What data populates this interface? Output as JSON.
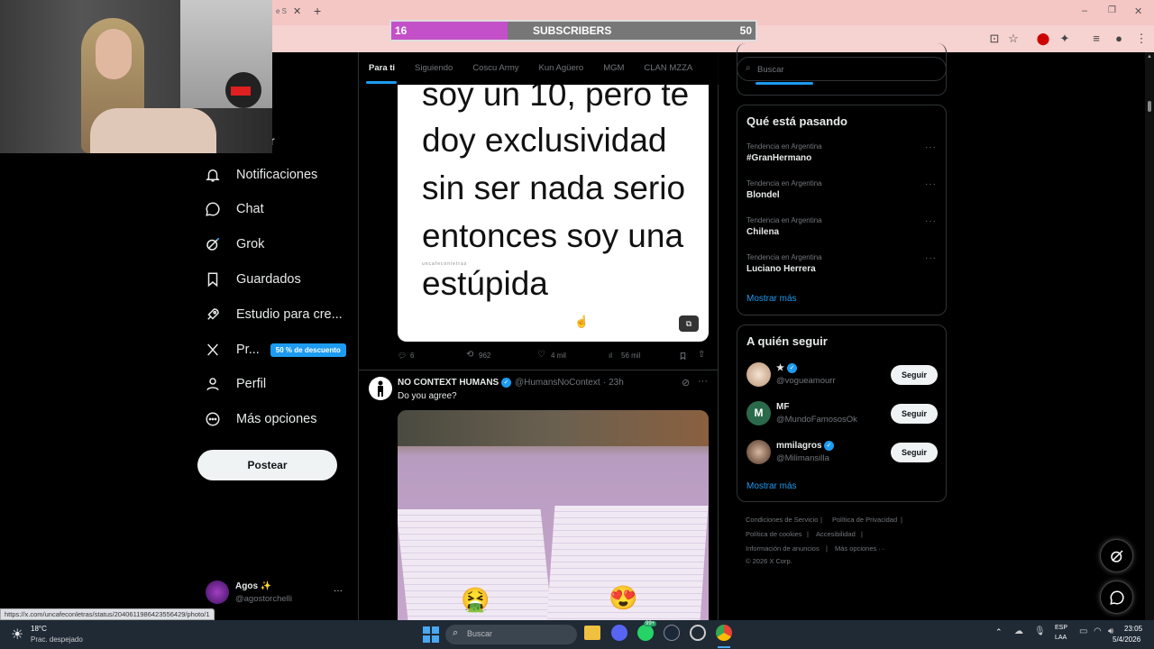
{
  "browser": {
    "tab_partial": "e S",
    "new_tab": "+",
    "window_controls": [
      "–",
      "❐",
      "✕"
    ]
  },
  "overlay": {
    "subscribers_current": "16",
    "subscribers_label": "SUBSCRIBERS",
    "subscribers_goal": "50",
    "progress_fraction": 0.32
  },
  "sidebar": {
    "partial_label": "r",
    "items": [
      {
        "label": "Notificaciones",
        "icon": "bell-icon"
      },
      {
        "label": "Chat",
        "icon": "chat-icon"
      },
      {
        "label": "Grok",
        "icon": "grok-icon"
      },
      {
        "label": "Guardados",
        "icon": "bookmark-icon"
      },
      {
        "label": "Estudio para cre...",
        "icon": "rocket-icon"
      },
      {
        "label": "Pr...",
        "icon": "x-logo-icon"
      },
      {
        "label": "Perfil",
        "icon": "person-icon"
      },
      {
        "label": "Más opciones",
        "icon": "more-circle-icon"
      }
    ],
    "premium_badge": "50 % de descuento",
    "post_button": "Postear",
    "account_name": "Agos ✨",
    "account_handle": "@agostorchelli",
    "account_more": "···"
  },
  "timeline": {
    "tabs": [
      "Para ti",
      "Siguiendo",
      "Coscu Army",
      "Kun Agüero",
      "MGM",
      "CLAN MZZA"
    ],
    "active_tab": 0,
    "tweet1": {
      "image_lines": [
        "soy un 10, pero te",
        "doy     exclusividad",
        "sin ser nada serio",
        "entonces  soy una",
        "estúpida"
      ],
      "watermark": "uncafeconletras",
      "replies": "6",
      "reposts": "962",
      "likes": "4 mil",
      "views": "56 mil"
    },
    "tweet2": {
      "author": "NO CONTEXT HUMANS",
      "handle": "@HumansNoContext",
      "time": "· 23h",
      "text": "Do you agree?",
      "emoji_left": "🤮",
      "emoji_right": "😍"
    }
  },
  "right": {
    "search_placeholder": "Buscar",
    "trends_title": "Qué está pasando",
    "trends": [
      {
        "meta": "Tendencia en Argentina",
        "name": "#GranHermano"
      },
      {
        "meta": "Tendencia en Argentina",
        "name": "Blondel"
      },
      {
        "meta": "Tendencia en Argentina",
        "name": "Chilena"
      },
      {
        "meta": "Tendencia en Argentina",
        "name": "Luciano Herrera"
      }
    ],
    "show_more": "Mostrar más",
    "follow_title": "A quién seguir",
    "follow": [
      {
        "name": "★",
        "handle": "@vogueamourr",
        "button": "Seguir"
      },
      {
        "name": "MF",
        "handle": "@MundoFamososOk",
        "button": "Seguir"
      },
      {
        "name": "mmilagros",
        "handle": "@Milimansilla",
        "button": "Seguir"
      }
    ],
    "follow_more": "Mostrar más",
    "footer": [
      "Condiciones de Servicio",
      "|",
      "Política de Privacidad",
      "|",
      "Política de cookies",
      "|",
      "Accesibilidad",
      "|",
      "Información de anuncios",
      "|",
      "Más opciones ···",
      "© 2026 X Corp."
    ]
  },
  "status_url": "https://x.com/uncafeconletras/status/2040611986423556429/photo/1",
  "taskbar": {
    "weather_temp": "18°C",
    "weather_desc": "Prac. despejado",
    "search_placeholder": "Buscar",
    "lang_top": "ESP",
    "lang_bottom": "LAA",
    "time": "23:05",
    "date": "5/4/2026",
    "badge": "99+"
  }
}
